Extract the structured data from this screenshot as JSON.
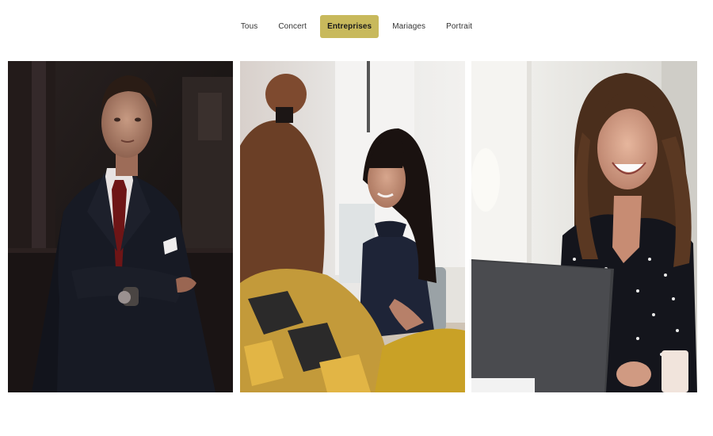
{
  "filters": {
    "items": [
      {
        "label": "Tous",
        "active": false
      },
      {
        "label": "Concert",
        "active": false
      },
      {
        "label": "Entreprises",
        "active": true
      },
      {
        "label": "Mariages",
        "active": false
      },
      {
        "label": "Portrait",
        "active": false
      }
    ]
  },
  "colors": {
    "active_tab": "#c8b95c",
    "background": "#ffffff"
  },
  "gallery": {
    "photos": [
      {
        "subject": "man in dark suit with red tie, arms crossed"
      },
      {
        "subject": "smiling woman in navy dress at office meeting, blurred person in foreground"
      },
      {
        "subject": "laughing woman with curly hair behind laptop"
      }
    ]
  }
}
